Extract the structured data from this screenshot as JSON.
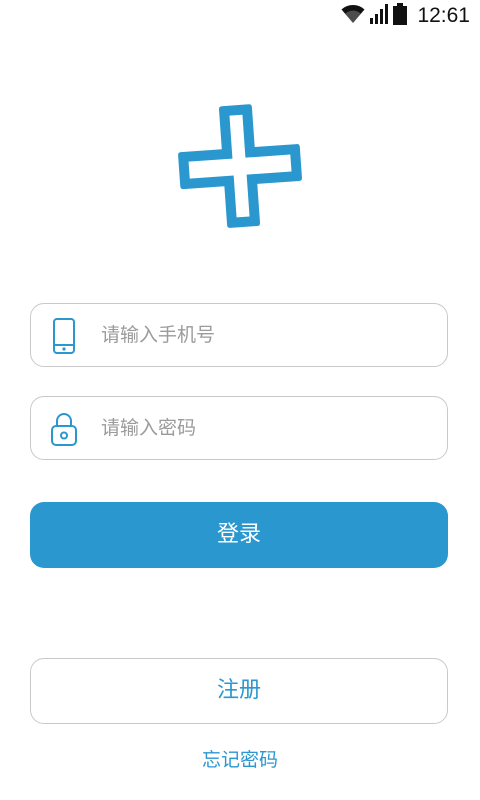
{
  "status_bar": {
    "time": "12:61",
    "icons": [
      "wifi-icon",
      "signal-icon",
      "battery-icon"
    ]
  },
  "logo": {
    "icon": "medical-cross-logo",
    "color": "#2b97cf"
  },
  "form": {
    "phone": {
      "icon": "phone-icon",
      "placeholder": "请输入手机号"
    },
    "password": {
      "icon": "lock-icon",
      "placeholder": "请输入密码"
    }
  },
  "actions": {
    "login_label": "登录",
    "register_label": "注册",
    "forgot_label": "忘记密码"
  },
  "colors": {
    "accent": "#2b97cf",
    "border": "#c9c9c9",
    "placeholder": "#9b9b9b"
  }
}
